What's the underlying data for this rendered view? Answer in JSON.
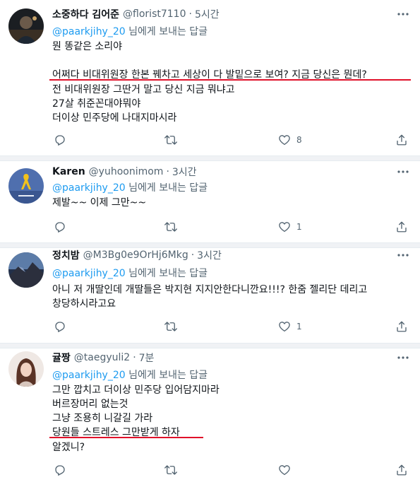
{
  "tweets": [
    {
      "name": "소중하다 김어준",
      "handle": "@florist7110",
      "time": "5시간",
      "reply_mention": "@paarkjihy_20",
      "reply_suffix": " 님에게 보내는 답글",
      "lines": [
        "뭔 똥같은 소리야",
        "",
        "어쩌다 비대위원장 한본 꿰차고 세상이 다 발밑으로 보여? 지금 당신은 뭔데?",
        "전 비대위원장 그딴거 말고 당신 지금 뭐냐고",
        "27살 취준꼰대야뭐야",
        "더이상 민주당에 나대지마시라"
      ],
      "counts": {
        "reply": "",
        "retweet": "",
        "like": "8"
      }
    },
    {
      "name": "Karen",
      "handle": "@yuhoonimom",
      "time": "3시간",
      "reply_mention": "@paarkjihy_20",
      "reply_suffix": " 님에게 보내는 답글",
      "lines": [
        "제발~~ 이제 그만~~"
      ],
      "counts": {
        "reply": "",
        "retweet": "",
        "like": "1"
      }
    },
    {
      "name": "정치밤",
      "handle": "@M3Bg0e9OrHj6Mkg",
      "time": "3시간",
      "reply_mention": "@paarkjihy_20",
      "reply_suffix": " 님에게 보내는 답글",
      "lines": [
        "아니 저 개딸인데 개딸들은 박지현 지지안한다니깐요!!!? 한줌 젤리단 데리고",
        "창당하시라고요"
      ],
      "counts": {
        "reply": "",
        "retweet": "",
        "like": "1"
      }
    },
    {
      "name": "귤짱",
      "handle": "@taegyuli2",
      "time": "7분",
      "reply_mention": "@paarkjihy_20",
      "reply_suffix": " 님에게 보내는 답글",
      "lines": [
        "그만 깝치고 더이상 민주당 입어담지마라",
        "버르장머리 없는것",
        "그냥 조용히 니갈길 가라",
        "당원들 스트레스 그만받게 하자",
        "알겠니?"
      ],
      "counts": {
        "reply": "",
        "retweet": "",
        "like": ""
      }
    }
  ],
  "separator": "·",
  "colors": {
    "text": "#0f1419",
    "muted": "#536471",
    "mention": "#1d9bf0",
    "highlight_underline": "#e0112a"
  },
  "icons": [
    "more-icon",
    "reply-icon",
    "retweet-icon",
    "like-icon",
    "share-icon"
  ]
}
